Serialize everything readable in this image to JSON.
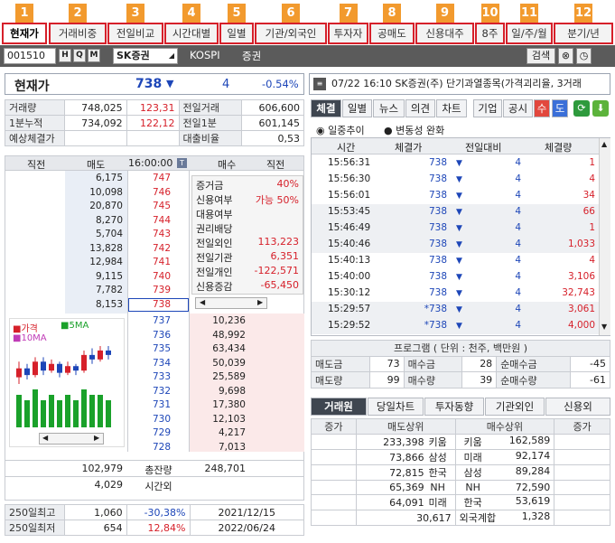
{
  "tabs": [
    {
      "num": "1",
      "label": "현재가"
    },
    {
      "num": "2",
      "label": "거래비중"
    },
    {
      "num": "3",
      "label": "전일비교"
    },
    {
      "num": "4",
      "label": "시간대별"
    },
    {
      "num": "5",
      "label": "일별"
    },
    {
      "num": "6",
      "label": "기관/외국인"
    },
    {
      "num": "7",
      "label": "투자자"
    },
    {
      "num": "8",
      "label": "공매도"
    },
    {
      "num": "9",
      "label": "신용대주"
    },
    {
      "num": "10",
      "label": "8주"
    },
    {
      "num": "11",
      "label": "일/주/월"
    },
    {
      "num": "12",
      "label": "분기/년"
    }
  ],
  "toolbar": {
    "code": "001510",
    "btn_h": "H",
    "btn_q": "Q",
    "btn_m": "M",
    "stock": "SK증권",
    "market": "KOSPI",
    "sector": "증권",
    "search": "검색"
  },
  "price": {
    "label": "현재가",
    "value": "738",
    "arrow": "▼",
    "change": "4",
    "pct": "-0.54%"
  },
  "stats": [
    [
      "거래량",
      "748,025",
      "123,31",
      "전일거래",
      "606,600"
    ],
    [
      "1분누적",
      "734,092",
      "122,12",
      "전일1분",
      "601,145"
    ],
    [
      "예상체결가",
      "",
      "",
      "대출비율",
      "0,53"
    ]
  ],
  "orderbook": {
    "hdr": [
      "직전",
      "매도",
      "16:00:00",
      "매수",
      "직전"
    ],
    "asks": [
      [
        "6,175",
        "747"
      ],
      [
        "10,098",
        "746"
      ],
      [
        "20,870",
        "745"
      ],
      [
        "8,270",
        "744"
      ],
      [
        "5,704",
        "743"
      ],
      [
        "13,828",
        "742"
      ],
      [
        "12,984",
        "741"
      ],
      [
        "9,115",
        "740"
      ],
      [
        "7,782",
        "739"
      ],
      [
        "8,153",
        "738"
      ]
    ],
    "bids": [
      [
        "737",
        "10,236"
      ],
      [
        "736",
        "48,992"
      ],
      [
        "735",
        "63,434"
      ],
      [
        "734",
        "50,039"
      ],
      [
        "733",
        "25,589"
      ],
      [
        "732",
        "9,698"
      ],
      [
        "731",
        "17,380"
      ],
      [
        "730",
        "12,103"
      ],
      [
        "729",
        "4,217"
      ],
      [
        "728",
        "7,013"
      ]
    ],
    "info": [
      [
        "증거금",
        "40%"
      ],
      [
        "신용여부",
        "가능 50%"
      ],
      [
        "대용여부",
        ""
      ],
      [
        "권리배당",
        ""
      ],
      [
        "전일외인",
        "113,223"
      ],
      [
        "전일기관",
        "6,351"
      ],
      [
        "전일개인",
        "-122,571"
      ],
      [
        "신용증감",
        "-65,450"
      ]
    ],
    "total_ask": "102,979",
    "total_label": "총잔량",
    "total_bid": "248,701",
    "after_ask": "4,029",
    "after_label": "시간외"
  },
  "chart_legend": {
    "price": "가격",
    "ma5": "5MA",
    "ma10": "10MA"
  },
  "chart_data": {
    "type": "candlestick",
    "candles": [
      {
        "o": 734,
        "c": 738,
        "h": 741,
        "l": 731
      },
      {
        "o": 738,
        "c": 735,
        "h": 740,
        "l": 733
      },
      {
        "o": 735,
        "c": 741,
        "h": 743,
        "l": 734
      },
      {
        "o": 741,
        "c": 737,
        "h": 743,
        "l": 735
      },
      {
        "o": 737,
        "c": 740,
        "h": 742,
        "l": 736
      },
      {
        "o": 740,
        "c": 736,
        "h": 741,
        "l": 734
      },
      {
        "o": 736,
        "c": 739,
        "h": 741,
        "l": 735
      },
      {
        "o": 739,
        "c": 737,
        "h": 740,
        "l": 735
      },
      {
        "o": 737,
        "c": 744,
        "h": 746,
        "l": 736
      },
      {
        "o": 744,
        "c": 742,
        "h": 747,
        "l": 740
      },
      {
        "o": 742,
        "c": 746,
        "h": 748,
        "l": 741
      },
      {
        "o": 746,
        "c": 744,
        "h": 748,
        "l": 742
      }
    ],
    "volume": [
      6,
      5,
      7,
      5,
      6,
      5,
      6,
      5,
      7,
      6,
      6,
      5
    ]
  },
  "hilo": [
    [
      "250일최고",
      "1,060",
      "-30,38%",
      "2021/12/15"
    ],
    [
      "250일최저",
      "654",
      "12,84%",
      "2022/06/24"
    ]
  ],
  "news": {
    "text": "07/22 16:10  SK증권(주) 단기과열종목(가격괴리율, 3거래"
  },
  "rtabs": [
    "체결",
    "일별",
    "뉴스",
    "의견",
    "차트",
    "기업",
    "공시",
    "수",
    "도"
  ],
  "radio": {
    "a": "일중추이",
    "b": "변동성 완화"
  },
  "ticks": {
    "hdr": [
      "시간",
      "체결가",
      "전일대비",
      "체결량"
    ],
    "rows": [
      [
        "15:56:31",
        "738",
        "▼",
        "4",
        "1"
      ],
      [
        "15:56:30",
        "738",
        "▼",
        "4",
        "4"
      ],
      [
        "15:56:01",
        "738",
        "▼",
        "4",
        "34"
      ],
      [
        "15:53:45",
        "738",
        "▼",
        "4",
        "66"
      ],
      [
        "15:46:49",
        "738",
        "▼",
        "4",
        "1"
      ],
      [
        "15:40:46",
        "738",
        "▼",
        "4",
        "1,033"
      ],
      [
        "15:40:13",
        "738",
        "▼",
        "4",
        "4"
      ],
      [
        "15:40:00",
        "738",
        "▼",
        "4",
        "3,106"
      ],
      [
        "15:30:12",
        "738",
        "▼",
        "4",
        "32,743"
      ],
      [
        "15:29:57",
        "*738",
        "▼",
        "4",
        "3,061"
      ],
      [
        "15:29:52",
        "*738",
        "▼",
        "4",
        "4,000"
      ]
    ]
  },
  "program": {
    "title": "프로그램 ( 단위 : 천주, 백만원 )",
    "r1": [
      "매도금",
      "73",
      "매수금",
      "28",
      "순매수금",
      "-45"
    ],
    "r2": [
      "매도량",
      "99",
      "매수량",
      "39",
      "순매수량",
      "-61"
    ]
  },
  "broker": {
    "tabs": [
      "거래원",
      "당일차트",
      "투자동향",
      "기관외인",
      "신용외"
    ],
    "hdr": [
      "증가",
      "매도상위",
      "매수상위",
      "증가"
    ],
    "rows": [
      [
        "233,398",
        "키움",
        "키움",
        "162,589"
      ],
      [
        "73,866",
        "삼성",
        "미래",
        "92,174"
      ],
      [
        "72,815",
        "한국",
        "삼성",
        "89,284"
      ],
      [
        "65,369",
        "NH",
        "NH",
        "72,590"
      ],
      [
        "64,091",
        "미래",
        "한국",
        "53,619"
      ]
    ],
    "foreign": [
      "30,617",
      "외국계합",
      "1,328"
    ]
  }
}
